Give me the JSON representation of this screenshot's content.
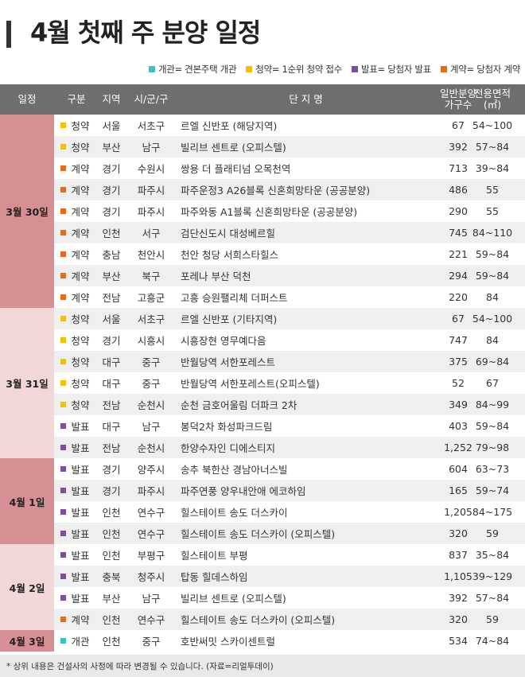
{
  "title": "4월 첫째 주 분양 일정",
  "legend": [
    {
      "text": "개관= 견본주택 개관",
      "color": "#3fbfbf"
    },
    {
      "text": "청약= 1순위 청약 접수",
      "color": "#f2c200"
    },
    {
      "text": "발표= 당첨자 발표",
      "color": "#7b4f9e"
    },
    {
      "text": "계약= 당첨자 계약",
      "color": "#e46c1a"
    }
  ],
  "header": {
    "date": "일정",
    "type": "구분",
    "region": "지역",
    "city": "시/군/구",
    "name": "단 지 명",
    "units": "일반분양\n가구수",
    "area": "전용면적\n(㎡)"
  },
  "type_colors": {
    "청약": "#f2c200",
    "계약": "#e46c1a",
    "발표": "#7b4f9e",
    "개관": "#3fbfbf"
  },
  "groups": [
    {
      "date": "3월 30일",
      "color": "#d68f92",
      "rows": [
        {
          "type": "청약",
          "region": "서울",
          "city": "서초구",
          "name": "르엘 신반포 (해당지역)",
          "units": "67",
          "area": "54~100"
        },
        {
          "type": "청약",
          "region": "부산",
          "city": "남구",
          "name": "빌리브 센트로 (오피스텔)",
          "units": "392",
          "area": "57~84"
        },
        {
          "type": "계약",
          "region": "경기",
          "city": "수원시",
          "name": "쌍용 더 플래티넘 오목천역",
          "units": "713",
          "area": "39~84"
        },
        {
          "type": "계약",
          "region": "경기",
          "city": "파주시",
          "name": "파주운정3 A26블록 신혼희망타운 (공공분양)",
          "units": "486",
          "area": "55"
        },
        {
          "type": "계약",
          "region": "경기",
          "city": "파주시",
          "name": "파주와동 A1블록 신혼희망타운 (공공분양)",
          "units": "290",
          "area": "55"
        },
        {
          "type": "계약",
          "region": "인천",
          "city": "서구",
          "name": "검단신도시 대성베르힐",
          "units": "745",
          "area": "84~110"
        },
        {
          "type": "계약",
          "region": "충남",
          "city": "천안시",
          "name": "천안 청당 서희스타힐스",
          "units": "221",
          "area": "59~84"
        },
        {
          "type": "계약",
          "region": "부산",
          "city": "북구",
          "name": "포레나 부산 덕천",
          "units": "294",
          "area": "59~84"
        },
        {
          "type": "계약",
          "region": "전남",
          "city": "고흥군",
          "name": "고흥 승원팰리체 더퍼스트",
          "units": "220",
          "area": "84"
        }
      ]
    },
    {
      "date": "3월 31일",
      "color": "#f2d7d8",
      "rows": [
        {
          "type": "청약",
          "region": "서울",
          "city": "서초구",
          "name": "르엘 신반포 (기타지역)",
          "units": "67",
          "area": "54~100"
        },
        {
          "type": "청약",
          "region": "경기",
          "city": "시흥시",
          "name": "시흥장현 영무예다음",
          "units": "747",
          "area": "84"
        },
        {
          "type": "청약",
          "region": "대구",
          "city": "중구",
          "name": "반월당역 서한포레스트",
          "units": "375",
          "area": "69~84"
        },
        {
          "type": "청약",
          "region": "대구",
          "city": "중구",
          "name": "반월당역 서한포레스트(오피스텔)",
          "units": "52",
          "area": "67"
        },
        {
          "type": "청약",
          "region": "전남",
          "city": "순천시",
          "name": "순천 금호어울림 더파크 2차",
          "units": "349",
          "area": "84~99"
        },
        {
          "type": "발표",
          "region": "대구",
          "city": "남구",
          "name": "봉덕2차 화성파크드림",
          "units": "403",
          "area": "59~84"
        },
        {
          "type": "발표",
          "region": "전남",
          "city": "순천시",
          "name": "한양수자인 디에스티지",
          "units": "1,252",
          "area": "79~98"
        }
      ]
    },
    {
      "date": "4월 1일",
      "color": "#d68f92",
      "rows": [
        {
          "type": "발표",
          "region": "경기",
          "city": "양주시",
          "name": "송추 북한산 경남아너스빌",
          "units": "604",
          "area": "63~73"
        },
        {
          "type": "발표",
          "region": "경기",
          "city": "파주시",
          "name": "파주연풍 양우내안애 에코하임",
          "units": "165",
          "area": "59~74"
        },
        {
          "type": "발표",
          "region": "인천",
          "city": "연수구",
          "name": "힐스테이트 송도 더스카이",
          "units": "1,205",
          "area": "84~175"
        },
        {
          "type": "발표",
          "region": "인천",
          "city": "연수구",
          "name": "힐스테이트 송도 더스카이 (오피스텔)",
          "units": "320",
          "area": "59"
        }
      ]
    },
    {
      "date": "4월 2일",
      "color": "#f2d7d8",
      "rows": [
        {
          "type": "발표",
          "region": "인천",
          "city": "부평구",
          "name": "힐스테이트 부평",
          "units": "837",
          "area": "35~84"
        },
        {
          "type": "발표",
          "region": "충북",
          "city": "청주시",
          "name": "탑동 힐데스하임",
          "units": "1,105",
          "area": "39~129"
        },
        {
          "type": "발표",
          "region": "부산",
          "city": "남구",
          "name": "빌리브 센트로 (오피스텔)",
          "units": "392",
          "area": "57~84"
        },
        {
          "type": "계약",
          "region": "인천",
          "city": "연수구",
          "name": "힐스테이트 송도 더스카이 (오피스텔)",
          "units": "320",
          "area": "59"
        }
      ]
    },
    {
      "date": "4월 3일",
      "color": "#d68f92",
      "rows": [
        {
          "type": "개관",
          "region": "인천",
          "city": "중구",
          "name": "호반써밋 스카이센트럴",
          "units": "534",
          "area": "74~84"
        }
      ]
    }
  ],
  "footer": "* 상위 내용은 건설사의 사정에 따라 변경될 수 있습니다. (자료=리얼투데이)"
}
